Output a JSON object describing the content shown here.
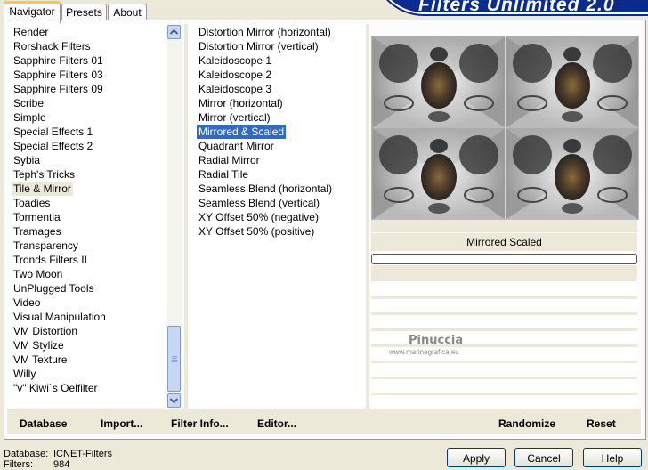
{
  "app": {
    "banner": "Filters Unlimited 2.0"
  },
  "tabs": [
    "Navigator",
    "Presets",
    "About"
  ],
  "categories": [
    "Render",
    "Rorshack Filters",
    "Sapphire Filters 01",
    "Sapphire Filters 03",
    "Sapphire Filters 09",
    "Scribe",
    "Simple",
    "Special Effects 1",
    "Special Effects 2",
    "Sybia",
    "Teph's Tricks",
    "Tile & Mirror",
    "Toadies",
    "Tormentia",
    "Tramages",
    "Transparency",
    "Tronds Filters II",
    "Two Moon",
    "UnPlugged Tools",
    "Video",
    "Visual Manipulation",
    "VM Distortion",
    "VM Stylize",
    "VM Texture",
    "Willy",
    "\"v\" Kiwi`s Oelfilter"
  ],
  "selected_category": "Tile & Mirror",
  "filters": [
    "Distortion Mirror (horizontal)",
    "Distortion Mirror (vertical)",
    "Kaleidoscope 1",
    "Kaleidoscope 2",
    "Kaleidoscope 3",
    "Mirror (horizontal)",
    "Mirror (vertical)",
    "Mirrored & Scaled",
    "Quadrant Mirror",
    "Radial Mirror",
    "Radial Tile",
    "Seamless Blend (horizontal)",
    "Seamless Blend (vertical)",
    "XY Offset 50% (negative)",
    "XY Offset 50% (positive)"
  ],
  "selected_filter": "Mirrored & Scaled",
  "preview": {
    "filter_name": "Mirrored  Scaled",
    "watermark": "Pinuccia",
    "watermark_url": "www.marinegrafica.eu"
  },
  "toolbar": {
    "database": "Database",
    "import": "Import...",
    "filter_info": "Filter Info...",
    "editor": "Editor...",
    "randomize": "Randomize",
    "reset": "Reset"
  },
  "status": {
    "database_label": "Database:",
    "database_value": "ICNET-Filters",
    "filters_label": "Filters:",
    "filters_value": "984"
  },
  "buttons": {
    "apply": "Apply",
    "cancel": "Cancel",
    "help": "Help"
  },
  "colors": {
    "selection_blue": "#316ac5",
    "banner_blue": "#0b2b8f",
    "face": "#ece9d8"
  }
}
